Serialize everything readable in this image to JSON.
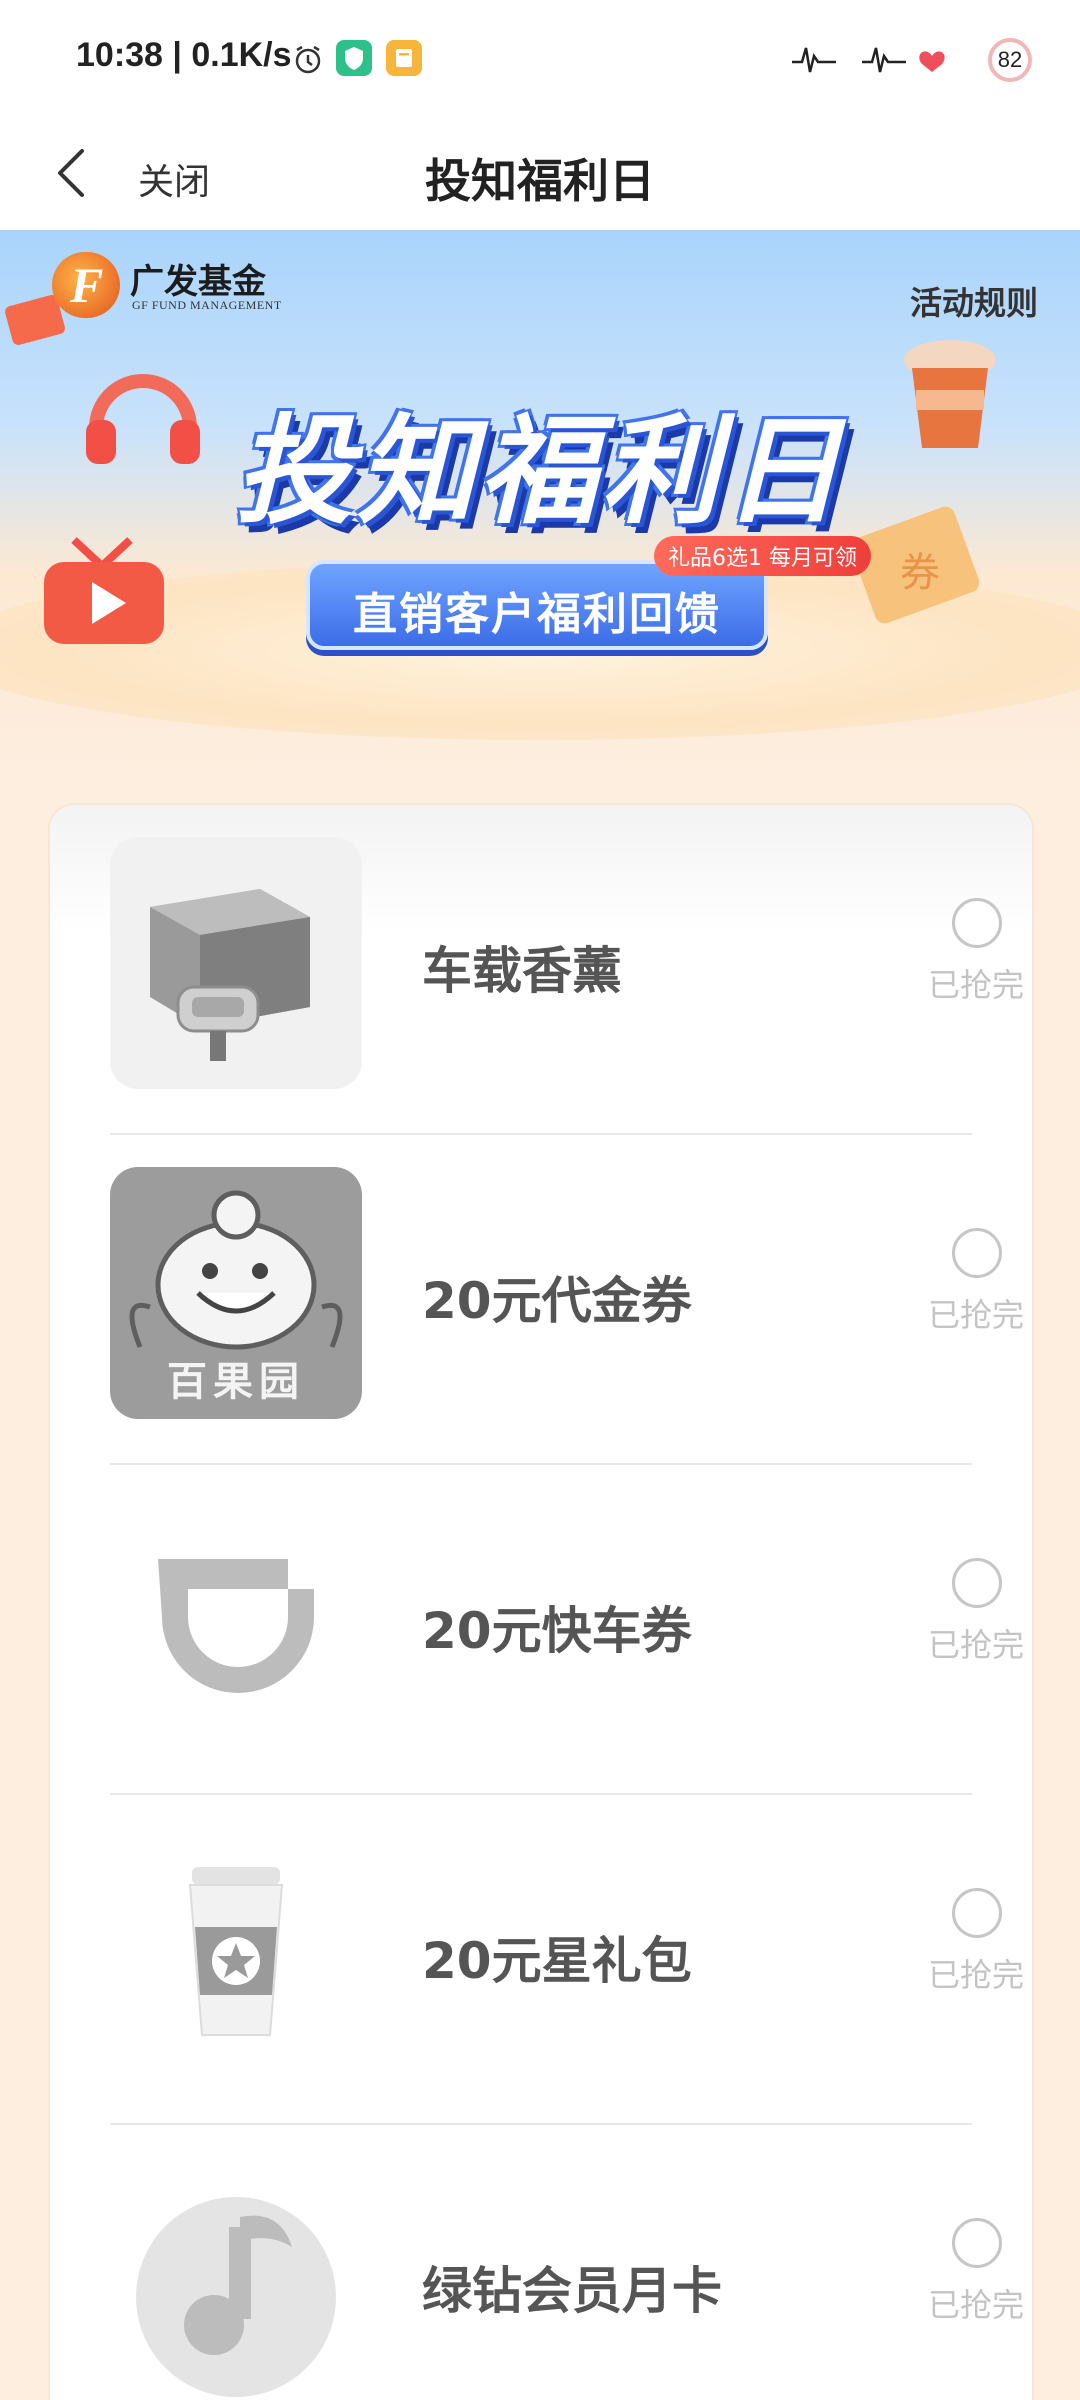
{
  "status_bar": {
    "time": "10:38 | 0.1K/s",
    "battery": "82"
  },
  "nav": {
    "close_label": "关闭",
    "title": "投知福利日"
  },
  "banner": {
    "brand_name": "广发基金",
    "brand_en": "GF FUND MANAGEMENT",
    "rules_label": "活动规则",
    "hero_title": "投知福利日",
    "gift_tag": "礼品6选1 每月可领",
    "subtitle": "直销客户福利回馈"
  },
  "prizes": [
    {
      "name": "车载香薰",
      "status": "已抢完",
      "icon": "car-diffuser-icon"
    },
    {
      "name": "20元代金券",
      "status": "已抢完",
      "icon": "baiguoyuan-logo-icon",
      "logo_text": "百果园"
    },
    {
      "name": "20元快车券",
      "status": "已抢完",
      "icon": "didi-logo-icon"
    },
    {
      "name": "20元星礼包",
      "status": "已抢完",
      "icon": "coffee-cup-icon"
    },
    {
      "name": "绿钻会员月卡",
      "status": "已抢完",
      "icon": "music-note-icon"
    }
  ],
  "colors": {
    "page_background": "#fdeee0",
    "hero_blue": "#3f74ee",
    "tag_red": "#ef3e3a",
    "disabled_gray": "#c4c4c4"
  }
}
